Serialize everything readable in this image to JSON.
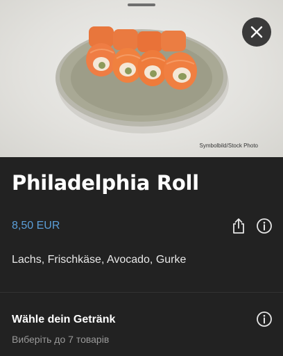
{
  "product": {
    "title": "Philadelphia Roll",
    "price": "8,50 EUR",
    "description": "Lachs, Frischkäse, Avocado, Gurke",
    "image_credit": "Symbolbild/Stock Photo"
  },
  "options": {
    "section_title": "Wähle dein Getränk",
    "section_subtitle": "Виберіть до 7 товарів"
  },
  "icons": {
    "close": "close-icon",
    "share": "share-icon",
    "info": "info-icon"
  },
  "colors": {
    "background": "#222222",
    "price": "#5b9fd9",
    "close_button": "#3a3a3a"
  }
}
